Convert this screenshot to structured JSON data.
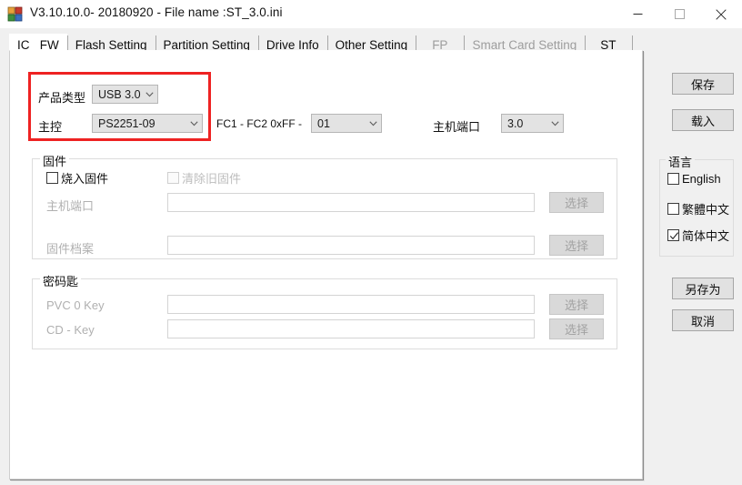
{
  "window": {
    "title": "V3.10.10.0- 20180920 - File name :ST_3.0.ini",
    "icon": "app-blocks-icon",
    "minimize_label": "minimize-icon",
    "maximize_label": "maximize-icon",
    "close_label": "close-icon"
  },
  "tabs": [
    {
      "label": "IC _FW",
      "active": true,
      "disabled": false
    },
    {
      "label": "Flash Setting",
      "active": false,
      "disabled": false
    },
    {
      "label": "Partition Setting",
      "active": false,
      "disabled": false
    },
    {
      "label": "Drive Info",
      "active": false,
      "disabled": false
    },
    {
      "label": "Other Setting",
      "active": false,
      "disabled": false
    },
    {
      "label": "FP",
      "active": false,
      "disabled": true
    },
    {
      "label": "Smart Card Setting",
      "active": false,
      "disabled": true
    },
    {
      "label": "ST",
      "active": false,
      "disabled": false
    }
  ],
  "highlight": {
    "color": "#ee2222",
    "product_type_label": "产品类型",
    "product_type_value": "USB 3.0",
    "controller_label": "主控",
    "controller_value": "PS2251-09"
  },
  "fc": {
    "label": "FC1 - FC2   0xFF -",
    "value": "01"
  },
  "host_port_top": {
    "label": "主机端口",
    "value": "3.0"
  },
  "firmware_group": {
    "title": "固件",
    "burn_checkbox": "烧入固件",
    "clear_checkbox": "清除旧固件",
    "host_port_label": "主机端口",
    "host_port_value": "",
    "firmware_file_label": "固件档案",
    "firmware_file_value": "",
    "select_button_1": "选择",
    "select_button_2": "选择"
  },
  "key_group": {
    "title": "密码匙",
    "pvc_key_label": "PVC 0 Key",
    "pvc_key_value": "",
    "cd_key_label": "CD - Key",
    "cd_key_value": "",
    "select_button_1": "选择",
    "select_button_2": "选择"
  },
  "sidebar": {
    "save_button": "保存",
    "load_button": "载入",
    "language_title": "语言",
    "languages": [
      {
        "label": "English",
        "checked": false
      },
      {
        "label": "繁體中文",
        "checked": false
      },
      {
        "label": "简体中文",
        "checked": true
      }
    ],
    "save_as_button": "另存为",
    "cancel_button": "取消"
  }
}
